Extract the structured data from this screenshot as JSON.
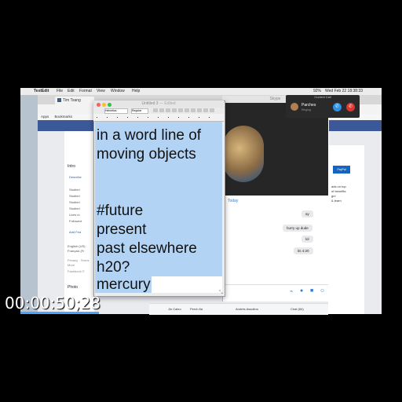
{
  "menubar": {
    "app": "TextEdit",
    "items": [
      "File",
      "Edit",
      "Format",
      "View",
      "Window",
      "Help"
    ],
    "battery": "92%",
    "datetime": "Wed Feb 22  18:38:33"
  },
  "browser": {
    "tab_label": "Tim Tsang",
    "bookmarks": [
      "Apps",
      "Bookmarks"
    ],
    "sidebar": [
      "Intro",
      "Describe",
      "Studied",
      "Studied",
      "Studied",
      "Studied",
      "Lives in",
      "Followed",
      "Add Fea",
      "English (US)",
      "Français (Fr",
      "Privacy · Terms",
      "More",
      "Facebook ©",
      "Photo"
    ],
    "right_text": [
      "PayPal",
      "ads on top",
      "of benefits",
      "go!",
      "& learn"
    ],
    "bottom_bar": [
      "Jin Caleo",
      "Perch 8a",
      "Andrés Assolina",
      "Chat (84)"
    ]
  },
  "messenger": {
    "title": "Skype",
    "day_label": "Today",
    "messages": [
      "ay",
      "hurry up dude",
      "lol",
      "its 4:20"
    ]
  },
  "call": {
    "header": "Current Call",
    "name": "Parches",
    "status": "Ringing",
    "answer_icon": "phone-icon",
    "decline_icon": "phone-hangup-icon"
  },
  "textedit": {
    "title": "Untitled 3",
    "title_suffix": "— Edited",
    "font_name": "Helvetica",
    "font_style": "Regular",
    "lines": [
      "in a word line of",
      "moving objects",
      "",
      "#future",
      "present",
      "past elsewhere",
      "h20?",
      "mercury"
    ]
  },
  "overlay": {
    "timecode": "00:00:50;28"
  }
}
